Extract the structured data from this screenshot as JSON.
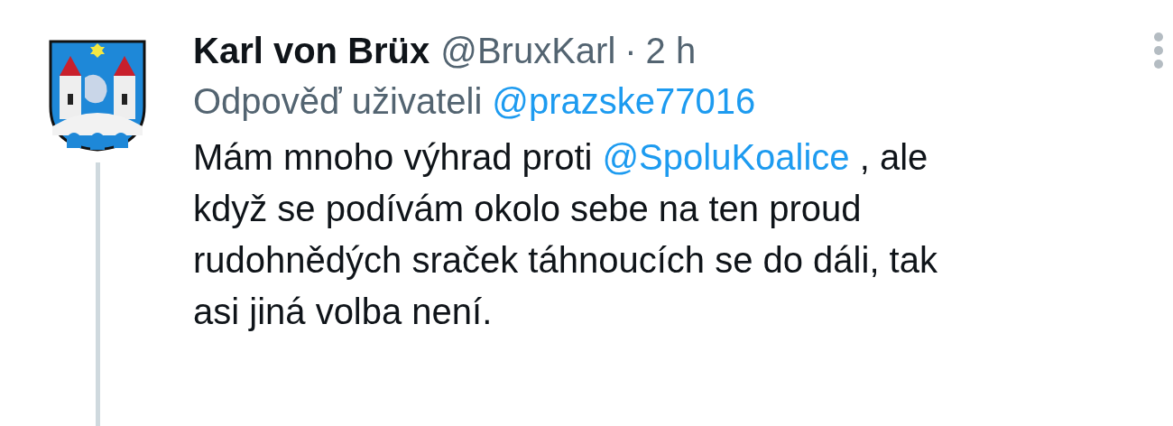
{
  "tweet": {
    "author_name": "Karl von Brüx",
    "handle": "@BruxKarl",
    "separator": "·",
    "time": "2 h",
    "reply_prefix": "Odpověď uživateli",
    "reply_to": "@prazske77016",
    "body_lines": [
      [
        {
          "kind": "text",
          "text": "Mám mnoho výhrad proti "
        },
        {
          "kind": "mention",
          "text": "@SpoluKoalice"
        },
        {
          "kind": "text",
          "text": " , ale"
        }
      ],
      [
        {
          "kind": "text",
          "text": "když se podívám okolo sebe na ten proud"
        }
      ],
      [
        {
          "kind": "text",
          "text": "rudohnědých sraček táhnoucích se do dáli, tak"
        }
      ],
      [
        {
          "kind": "text",
          "text": "asi jiná volba není."
        }
      ]
    ]
  }
}
